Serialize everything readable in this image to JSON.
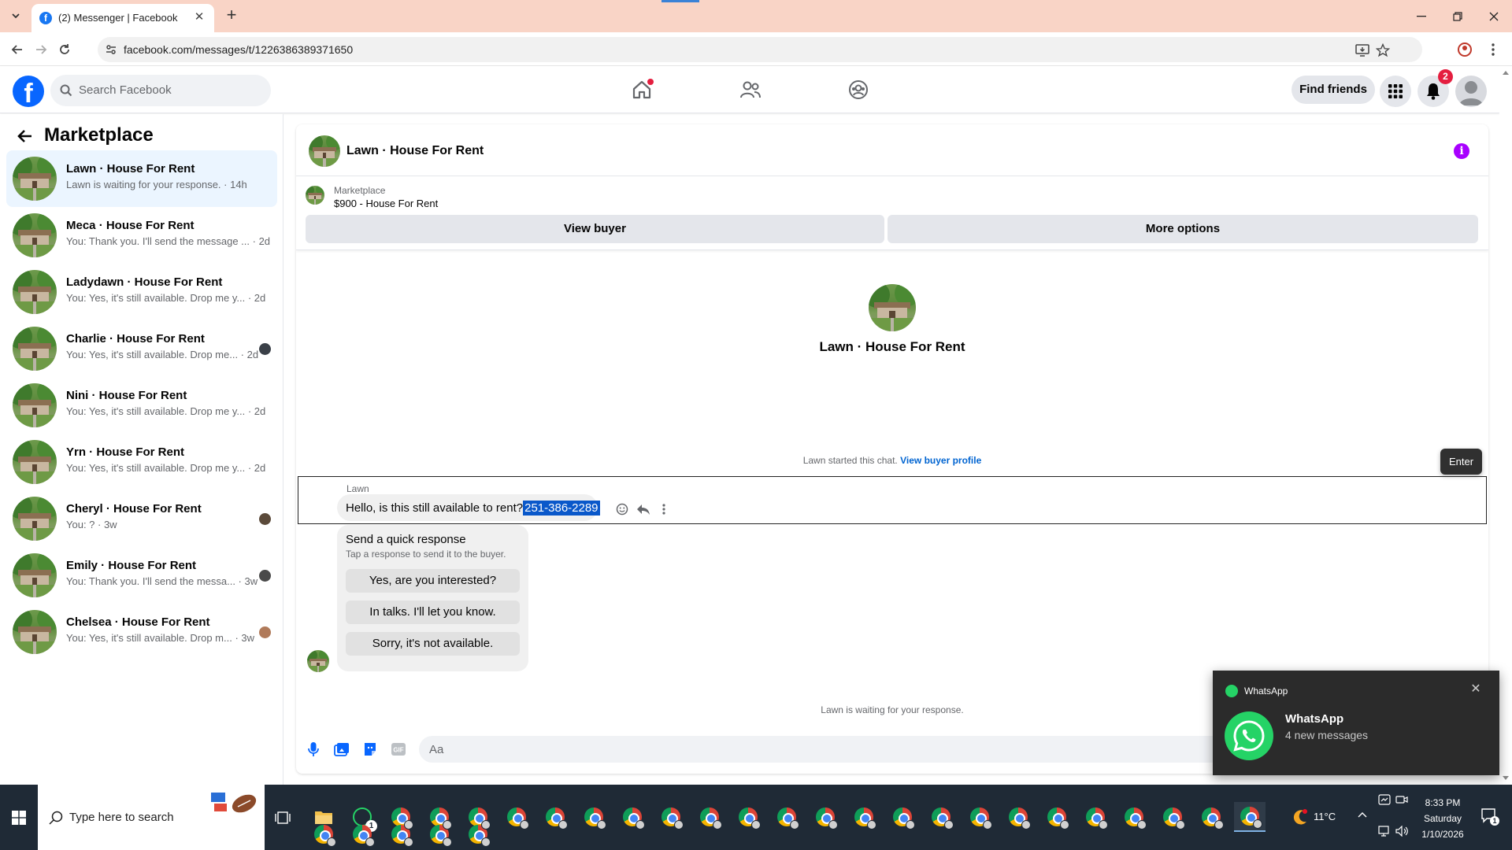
{
  "browser": {
    "tab_title": "(2) Messenger | Facebook",
    "url": "facebook.com/messages/t/1226386389371650",
    "tab_favicon_letter": "f"
  },
  "fb_header": {
    "search_placeholder": "Search Facebook",
    "find_friends": "Find friends",
    "notification_count": "2",
    "logo_letter": "f"
  },
  "sidebar": {
    "title": "Marketplace",
    "conversations": [
      {
        "name": "Lawn · House For Rent",
        "preview": "Lawn is waiting for your response. · 14h",
        "active": true
      },
      {
        "name": "Meca · House For Rent",
        "preview": "You: Thank you. I'll send the message ... · 2d"
      },
      {
        "name": "Ladydawn · House For Rent",
        "preview": "You: Yes, it's still available. Drop me y... · 2d"
      },
      {
        "name": "Charlie · House For Rent",
        "preview": "You: Yes, it's still available. Drop me... · 2d"
      },
      {
        "name": "Nini · House For Rent",
        "preview": "You: Yes, it's still available. Drop me y... · 2d"
      },
      {
        "name": "Yrn · House For Rent",
        "preview": "You: Yes, it's still available. Drop me y... · 2d"
      },
      {
        "name": "Cheryl · House For Rent",
        "preview": "You: ? · 3w"
      },
      {
        "name": "Emily · House For Rent",
        "preview": "You: Thank you. I'll send the messa... · 3w"
      },
      {
        "name": "Chelsea · House For Rent",
        "preview": "You: Yes, it's still available. Drop m... · 3w"
      }
    ]
  },
  "chat": {
    "title": "Lawn · House For Rent",
    "marketplace_label": "Marketplace",
    "listing": "$900 - House For Rent",
    "view_buyer": "View buyer",
    "more_options": "More options",
    "center_name": "Lawn · House For Rent",
    "started_text": "Lawn started this chat.",
    "view_buyer_profile": "View buyer profile",
    "enter_tooltip": "Enter",
    "sender": "Lawn",
    "message_text": "Hello, is this still available to rent?",
    "message_phone": "251-386-2289",
    "quick_response_title": "Send a quick response",
    "quick_response_sub": "Tap a response to send it to the buyer.",
    "quick_responses": [
      "Yes, are you interested?",
      "In talks. I'll let you know.",
      "Sorry, it's not available."
    ],
    "waiting_text": "Lawn is waiting for your response.",
    "composer_placeholder": "Aa",
    "gif_label": "GIF"
  },
  "toast": {
    "app": "WhatsApp",
    "title": "WhatsApp",
    "body": "4 new messages"
  },
  "taskbar": {
    "search_placeholder": "Type here to search",
    "whatsapp_badge": "1",
    "temperature": "11°C",
    "time": "8:33 PM",
    "day": "Saturday",
    "date": "1/10/2026",
    "notif_count": "1"
  },
  "colors": {
    "fb_blue": "#0866ff",
    "tab_strip": "#f9d4c6",
    "info_purple": "#a800ff",
    "whatsapp_green": "#25d366",
    "highlight": "#0a58ca"
  }
}
